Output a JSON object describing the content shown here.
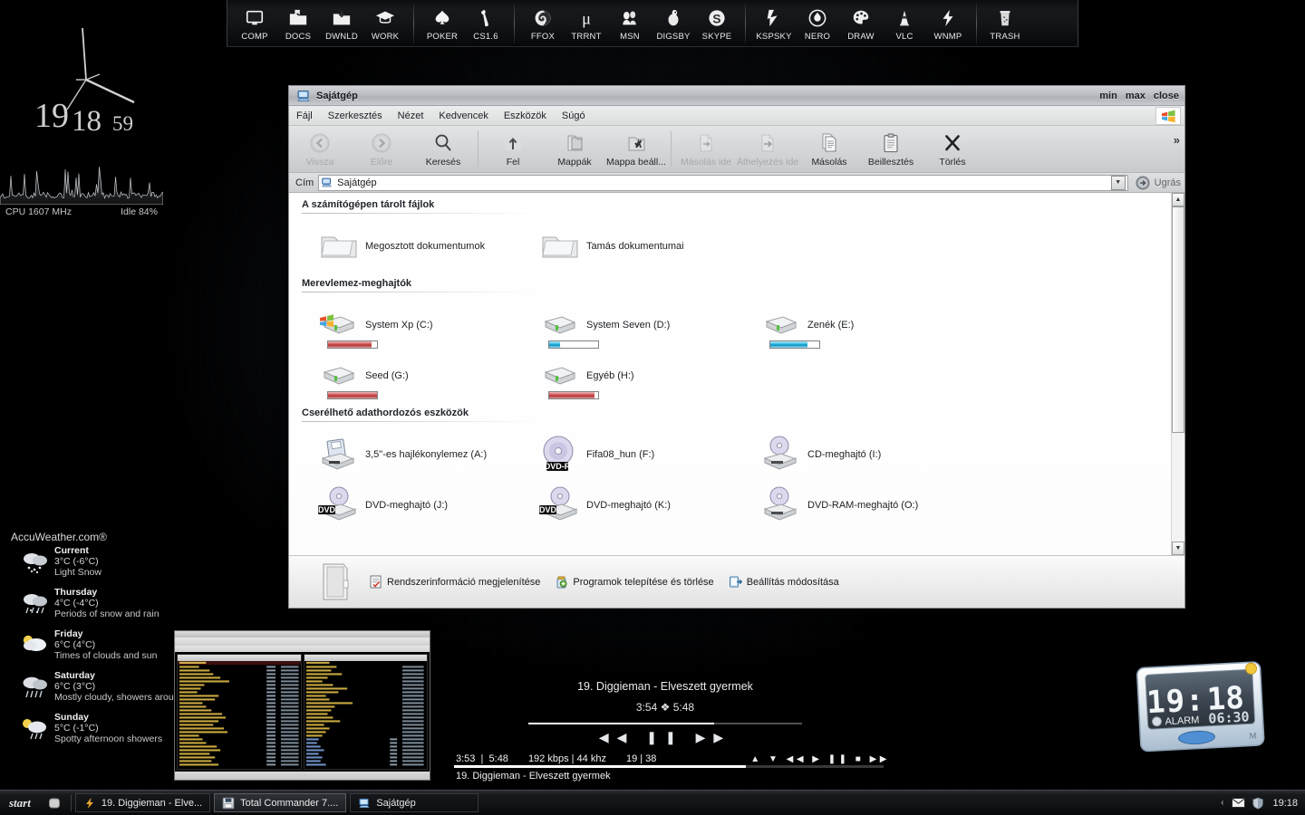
{
  "dock": {
    "groups": [
      {
        "items": [
          {
            "label": "COMP",
            "icon": "monitor-icon"
          },
          {
            "label": "DOCS",
            "icon": "documents-folder-icon"
          },
          {
            "label": "DWNLD",
            "icon": "download-folder-icon"
          },
          {
            "label": "WORK",
            "icon": "graduation-cap-icon"
          }
        ]
      },
      {
        "items": [
          {
            "label": "POKER",
            "icon": "spade-icon"
          },
          {
            "label": "CS1.6",
            "icon": "counterstrike-icon"
          }
        ]
      },
      {
        "items": [
          {
            "label": "FFOX",
            "icon": "firefox-icon"
          },
          {
            "label": "TRRNT",
            "icon": "utorrent-icon"
          },
          {
            "label": "MSN",
            "icon": "messenger-icon"
          },
          {
            "label": "DIGSBY",
            "icon": "digsby-icon"
          },
          {
            "label": "SKYPE",
            "icon": "skype-icon"
          }
        ]
      },
      {
        "items": [
          {
            "label": "KSPSKY",
            "icon": "kaspersky-icon"
          },
          {
            "label": "NERO",
            "icon": "nero-icon"
          },
          {
            "label": "DRAW",
            "icon": "paint-palette-icon"
          },
          {
            "label": "VLC",
            "icon": "vlc-cone-icon"
          },
          {
            "label": "WNMP",
            "icon": "winamp-lightning-icon"
          }
        ]
      },
      {
        "items": [
          {
            "label": "TRASH",
            "icon": "trash-icon"
          }
        ]
      }
    ]
  },
  "clock_widget": {
    "hour": "19",
    "minute": "18",
    "second": "59"
  },
  "cpu_meter": {
    "cpu_label": "CPU 1607 MHz",
    "idle_label": "Idle 84%",
    "cpu_mhz": 1607,
    "idle_percent": 84
  },
  "weather": {
    "brand": "AccuWeather.com®",
    "days": [
      {
        "day": "Current",
        "temp": "3°C (-6°C)",
        "desc": "Light Snow",
        "icon": "snow-icon"
      },
      {
        "day": "Thursday",
        "temp": "4°C (-4°C)",
        "desc": "Periods of snow and rain",
        "icon": "snow-rain-icon"
      },
      {
        "day": "Friday",
        "temp": "6°C (4°C)",
        "desc": "Times of clouds and sun",
        "icon": "sun-cloud-icon"
      },
      {
        "day": "Saturday",
        "temp": "6°C (3°C)",
        "desc": "Mostly cloudy, showers arou",
        "icon": "rain-icon"
      },
      {
        "day": "Sunday",
        "temp": "5°C (-1°C)",
        "desc": "Spotty afternoon showers",
        "icon": "sun-shower-icon"
      }
    ]
  },
  "explorer": {
    "title": "Sajátgép",
    "window_buttons": {
      "min": "min",
      "max": "max",
      "close": "close"
    },
    "menu": [
      "Fájl",
      "Szerkesztés",
      "Nézet",
      "Kedvencek",
      "Eszközök",
      "Súgó"
    ],
    "toolbar": {
      "groups": [
        [
          {
            "label": "Vissza",
            "icon": "back-arrow-icon",
            "disabled": true
          },
          {
            "label": "Előre",
            "icon": "forward-arrow-icon",
            "disabled": true
          },
          {
            "label": "Keresés",
            "icon": "magnifier-icon",
            "disabled": false
          }
        ],
        [
          {
            "label": "Fel",
            "icon": "up-folder-icon",
            "disabled": false
          },
          {
            "label": "Mappák",
            "icon": "folders-icon",
            "disabled": false
          },
          {
            "label": "Mappa beáll...",
            "icon": "folder-options-icon",
            "disabled": false
          }
        ],
        [
          {
            "label": "Másolás ide",
            "icon": "copy-to-icon",
            "disabled": true
          },
          {
            "label": "Áthelyezés ide",
            "icon": "move-to-icon",
            "disabled": true
          },
          {
            "label": "Másolás",
            "icon": "copy-icon",
            "disabled": false
          },
          {
            "label": "Beillesztés",
            "icon": "paste-icon",
            "disabled": false
          },
          {
            "label": "Törlés",
            "icon": "delete-x-icon",
            "disabled": false
          }
        ]
      ],
      "overflow": "»"
    },
    "address": {
      "label": "Cím",
      "value": "Sajátgép",
      "go_label": "Ugrás"
    },
    "sections": [
      {
        "heading": "A számítógépen tárolt fájlok",
        "items": [
          {
            "name": "Megosztott dokumentumok",
            "icon": "folder-icon"
          },
          {
            "name": "Tamás dokumentumai",
            "icon": "folder-icon"
          }
        ]
      },
      {
        "heading": "Merevlemez-meghajtók",
        "items": [
          {
            "name": "System Xp (C:)",
            "icon": "windows-drive-icon",
            "bar": "red",
            "fill": 88
          },
          {
            "name": "System Seven (D:)",
            "icon": "hdd-icon",
            "bar": "blue",
            "fill": 23
          },
          {
            "name": "Zenék (E:)",
            "icon": "hdd-icon",
            "bar": "blue",
            "fill": 76
          },
          {
            "name": "Seed (G:)",
            "icon": "hdd-icon",
            "bar": "red",
            "fill": 100
          },
          {
            "name": "Egyéb (H:)",
            "icon": "hdd-icon",
            "bar": "red",
            "fill": 93
          }
        ]
      },
      {
        "heading": "Cserélhető adathordozós eszközök",
        "items": [
          {
            "name": "3,5\"-es hajlékonylemez (A:)",
            "icon": "floppy-drive-icon"
          },
          {
            "name": "Fifa08_hun (F:)",
            "icon": "dvdr-disc-icon",
            "badge": "DVD-R"
          },
          {
            "name": "CD-meghajtó (I:)",
            "icon": "cd-drive-icon"
          },
          {
            "name": "DVD-meghajtó (J:)",
            "icon": "dvd-drive-icon",
            "badge": "DVD"
          },
          {
            "name": "DVD-meghajtó (K:)",
            "icon": "dvd-drive-icon",
            "badge": "DVD"
          },
          {
            "name": "DVD-RAM-meghajtó (O:)",
            "icon": "dvdram-drive-icon"
          }
        ]
      }
    ],
    "status_links": [
      {
        "label": "Rendszerinformáció megjelenítése",
        "icon": "system-info-icon"
      },
      {
        "label": "Programok telepítése és törlése",
        "icon": "add-remove-programs-icon"
      },
      {
        "label": "Beállítás módosítása",
        "icon": "control-panel-icon"
      }
    ]
  },
  "player": {
    "title": "19. Diggieman - Elveszett gyermek",
    "time_display": "3:54 ❖ 5:48",
    "controls": "◀◀  ❚❚  ▶▶",
    "elapsed": "3:53",
    "total": "5:48",
    "bitrate": "192 kbps | 44 khz",
    "track_index": "19 | 38",
    "transport": "▲ ▼ ◀◀ ▶ ❚❚ ■ ▶▶",
    "now_playing": "19. Diggieman - Elveszett gyermek",
    "progress_percent": 68
  },
  "alarm_clock": {
    "time": "19:18",
    "alarm_label": "ALARM",
    "alarm_time": "06:30",
    "brand_mark": "M"
  },
  "taskbar": {
    "start_label": "start",
    "quicklaunch": [
      {
        "icon": "show-desktop-icon"
      }
    ],
    "buttons": [
      {
        "label": "19. Diggieman - Elve...",
        "icon": "winamp-icon",
        "active": false
      },
      {
        "label": "Total Commander 7....",
        "icon": "totalcommander-icon",
        "active": true
      },
      {
        "label": "Sajátgép",
        "icon": "mycomputer-icon",
        "active": false
      }
    ],
    "tray": {
      "chevron": "‹",
      "icons": [
        "mail-icon",
        "shield-icon"
      ],
      "clock": "19:18"
    }
  }
}
